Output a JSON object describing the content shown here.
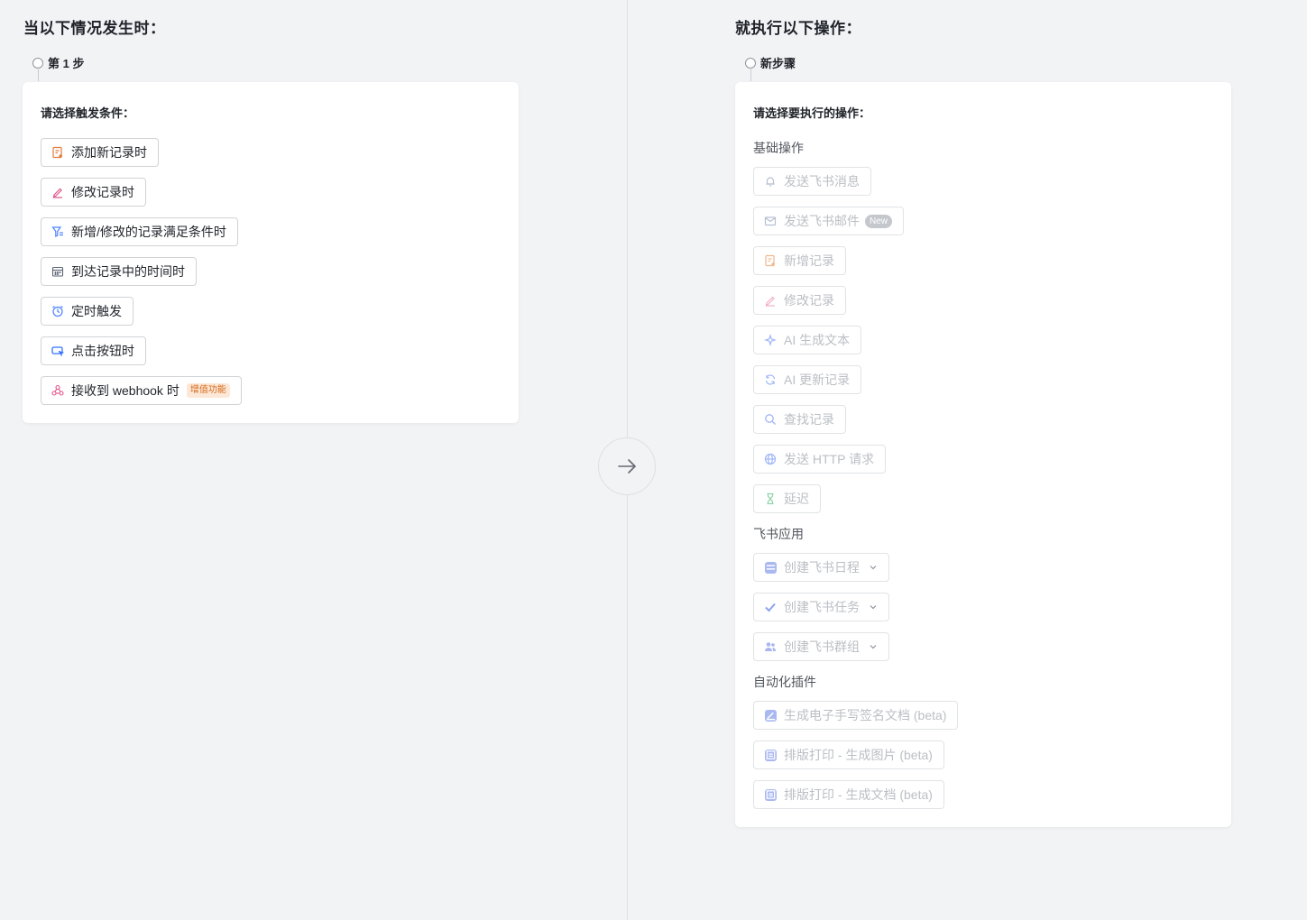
{
  "left": {
    "heading": "当以下情况发生时：",
    "step_label": "第 1 步",
    "card_title": "请选择触发条件：",
    "triggers": [
      {
        "label": "添加新记录时",
        "icon": "add-record-icon",
        "color": "#e07b39"
      },
      {
        "label": "修改记录时",
        "icon": "pencil-icon",
        "color": "#e0568a"
      },
      {
        "label": "新增/修改的记录满足条件时",
        "icon": "filter-icon",
        "color": "#4e83fd"
      },
      {
        "label": "到达记录中的时间时",
        "icon": "calendar-icon",
        "color": "#5b6573"
      },
      {
        "label": "定时触发",
        "icon": "alarm-clock-icon",
        "color": "#4e83fd"
      },
      {
        "label": "点击按钮时",
        "icon": "click-button-icon",
        "color": "#3370ff"
      },
      {
        "label": "接收到 webhook 时",
        "icon": "webhook-icon",
        "color": "#e0568a",
        "badge": "增值功能"
      }
    ]
  },
  "right": {
    "heading": "就执行以下操作：",
    "step_label": "新步骤",
    "card_title": "请选择要执行的操作：",
    "groups": [
      {
        "label": "基础操作",
        "actions": [
          {
            "label": "发送飞书消息",
            "icon": "bell-icon"
          },
          {
            "label": "发送飞书邮件",
            "icon": "mail-icon",
            "badge": "New"
          },
          {
            "label": "新增记录",
            "icon": "add-record-icon"
          },
          {
            "label": "修改记录",
            "icon": "pencil-icon"
          },
          {
            "label": "AI 生成文本",
            "icon": "ai-sparkle-icon"
          },
          {
            "label": "AI 更新记录",
            "icon": "refresh-icon"
          },
          {
            "label": "查找记录",
            "icon": "search-icon"
          },
          {
            "label": "发送 HTTP 请求",
            "icon": "globe-icon"
          },
          {
            "label": "延迟",
            "icon": "hourglass-icon"
          }
        ]
      },
      {
        "label": "飞书应用",
        "actions": [
          {
            "label": "创建飞书日程",
            "icon": "calendar-app-icon"
          },
          {
            "label": "创建飞书任务",
            "icon": "task-check-icon"
          },
          {
            "label": "创建飞书群组",
            "icon": "group-icon"
          }
        ]
      },
      {
        "label": "自动化插件",
        "actions": [
          {
            "label": "生成电子手写签名文档 (beta)",
            "icon": "signature-plugin-icon"
          },
          {
            "label": "排版打印 - 生成图片 (beta)",
            "icon": "print-plugin-icon"
          },
          {
            "label": "排版打印 - 生成文档 (beta)",
            "icon": "print-plugin-icon"
          }
        ]
      }
    ]
  },
  "colors": {
    "background": "#f2f3f5",
    "card": "#ffffff",
    "disabled_text": "#bbbfc4",
    "value_added_badge": "#d46a1c"
  }
}
